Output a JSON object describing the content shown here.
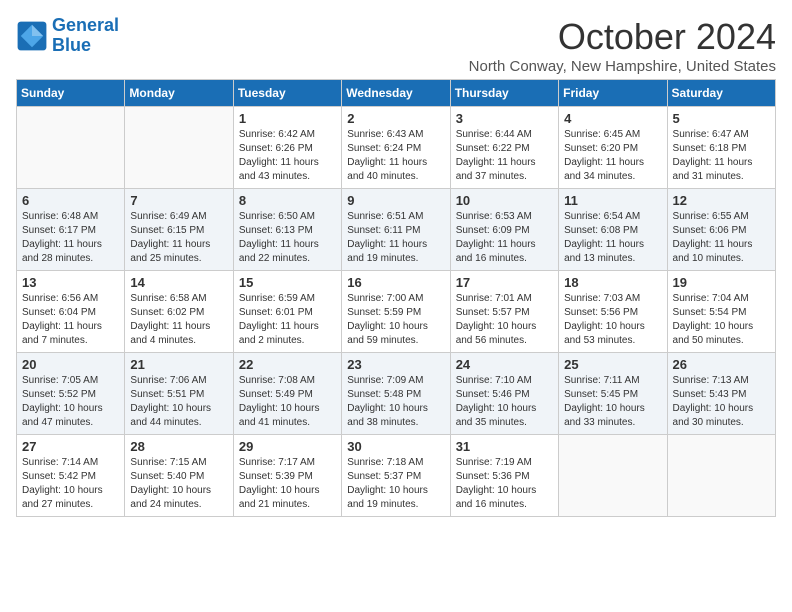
{
  "logo": {
    "line1": "General",
    "line2": "Blue"
  },
  "title": "October 2024",
  "location": "North Conway, New Hampshire, United States",
  "days_of_week": [
    "Sunday",
    "Monday",
    "Tuesday",
    "Wednesday",
    "Thursday",
    "Friday",
    "Saturday"
  ],
  "weeks": [
    [
      {
        "day": "",
        "sunrise": "",
        "sunset": "",
        "daylight": ""
      },
      {
        "day": "",
        "sunrise": "",
        "sunset": "",
        "daylight": ""
      },
      {
        "day": "1",
        "sunrise": "Sunrise: 6:42 AM",
        "sunset": "Sunset: 6:26 PM",
        "daylight": "Daylight: 11 hours and 43 minutes."
      },
      {
        "day": "2",
        "sunrise": "Sunrise: 6:43 AM",
        "sunset": "Sunset: 6:24 PM",
        "daylight": "Daylight: 11 hours and 40 minutes."
      },
      {
        "day": "3",
        "sunrise": "Sunrise: 6:44 AM",
        "sunset": "Sunset: 6:22 PM",
        "daylight": "Daylight: 11 hours and 37 minutes."
      },
      {
        "day": "4",
        "sunrise": "Sunrise: 6:45 AM",
        "sunset": "Sunset: 6:20 PM",
        "daylight": "Daylight: 11 hours and 34 minutes."
      },
      {
        "day": "5",
        "sunrise": "Sunrise: 6:47 AM",
        "sunset": "Sunset: 6:18 PM",
        "daylight": "Daylight: 11 hours and 31 minutes."
      }
    ],
    [
      {
        "day": "6",
        "sunrise": "Sunrise: 6:48 AM",
        "sunset": "Sunset: 6:17 PM",
        "daylight": "Daylight: 11 hours and 28 minutes."
      },
      {
        "day": "7",
        "sunrise": "Sunrise: 6:49 AM",
        "sunset": "Sunset: 6:15 PM",
        "daylight": "Daylight: 11 hours and 25 minutes."
      },
      {
        "day": "8",
        "sunrise": "Sunrise: 6:50 AM",
        "sunset": "Sunset: 6:13 PM",
        "daylight": "Daylight: 11 hours and 22 minutes."
      },
      {
        "day": "9",
        "sunrise": "Sunrise: 6:51 AM",
        "sunset": "Sunset: 6:11 PM",
        "daylight": "Daylight: 11 hours and 19 minutes."
      },
      {
        "day": "10",
        "sunrise": "Sunrise: 6:53 AM",
        "sunset": "Sunset: 6:09 PM",
        "daylight": "Daylight: 11 hours and 16 minutes."
      },
      {
        "day": "11",
        "sunrise": "Sunrise: 6:54 AM",
        "sunset": "Sunset: 6:08 PM",
        "daylight": "Daylight: 11 hours and 13 minutes."
      },
      {
        "day": "12",
        "sunrise": "Sunrise: 6:55 AM",
        "sunset": "Sunset: 6:06 PM",
        "daylight": "Daylight: 11 hours and 10 minutes."
      }
    ],
    [
      {
        "day": "13",
        "sunrise": "Sunrise: 6:56 AM",
        "sunset": "Sunset: 6:04 PM",
        "daylight": "Daylight: 11 hours and 7 minutes."
      },
      {
        "day": "14",
        "sunrise": "Sunrise: 6:58 AM",
        "sunset": "Sunset: 6:02 PM",
        "daylight": "Daylight: 11 hours and 4 minutes."
      },
      {
        "day": "15",
        "sunrise": "Sunrise: 6:59 AM",
        "sunset": "Sunset: 6:01 PM",
        "daylight": "Daylight: 11 hours and 2 minutes."
      },
      {
        "day": "16",
        "sunrise": "Sunrise: 7:00 AM",
        "sunset": "Sunset: 5:59 PM",
        "daylight": "Daylight: 10 hours and 59 minutes."
      },
      {
        "day": "17",
        "sunrise": "Sunrise: 7:01 AM",
        "sunset": "Sunset: 5:57 PM",
        "daylight": "Daylight: 10 hours and 56 minutes."
      },
      {
        "day": "18",
        "sunrise": "Sunrise: 7:03 AM",
        "sunset": "Sunset: 5:56 PM",
        "daylight": "Daylight: 10 hours and 53 minutes."
      },
      {
        "day": "19",
        "sunrise": "Sunrise: 7:04 AM",
        "sunset": "Sunset: 5:54 PM",
        "daylight": "Daylight: 10 hours and 50 minutes."
      }
    ],
    [
      {
        "day": "20",
        "sunrise": "Sunrise: 7:05 AM",
        "sunset": "Sunset: 5:52 PM",
        "daylight": "Daylight: 10 hours and 47 minutes."
      },
      {
        "day": "21",
        "sunrise": "Sunrise: 7:06 AM",
        "sunset": "Sunset: 5:51 PM",
        "daylight": "Daylight: 10 hours and 44 minutes."
      },
      {
        "day": "22",
        "sunrise": "Sunrise: 7:08 AM",
        "sunset": "Sunset: 5:49 PM",
        "daylight": "Daylight: 10 hours and 41 minutes."
      },
      {
        "day": "23",
        "sunrise": "Sunrise: 7:09 AM",
        "sunset": "Sunset: 5:48 PM",
        "daylight": "Daylight: 10 hours and 38 minutes."
      },
      {
        "day": "24",
        "sunrise": "Sunrise: 7:10 AM",
        "sunset": "Sunset: 5:46 PM",
        "daylight": "Daylight: 10 hours and 35 minutes."
      },
      {
        "day": "25",
        "sunrise": "Sunrise: 7:11 AM",
        "sunset": "Sunset: 5:45 PM",
        "daylight": "Daylight: 10 hours and 33 minutes."
      },
      {
        "day": "26",
        "sunrise": "Sunrise: 7:13 AM",
        "sunset": "Sunset: 5:43 PM",
        "daylight": "Daylight: 10 hours and 30 minutes."
      }
    ],
    [
      {
        "day": "27",
        "sunrise": "Sunrise: 7:14 AM",
        "sunset": "Sunset: 5:42 PM",
        "daylight": "Daylight: 10 hours and 27 minutes."
      },
      {
        "day": "28",
        "sunrise": "Sunrise: 7:15 AM",
        "sunset": "Sunset: 5:40 PM",
        "daylight": "Daylight: 10 hours and 24 minutes."
      },
      {
        "day": "29",
        "sunrise": "Sunrise: 7:17 AM",
        "sunset": "Sunset: 5:39 PM",
        "daylight": "Daylight: 10 hours and 21 minutes."
      },
      {
        "day": "30",
        "sunrise": "Sunrise: 7:18 AM",
        "sunset": "Sunset: 5:37 PM",
        "daylight": "Daylight: 10 hours and 19 minutes."
      },
      {
        "day": "31",
        "sunrise": "Sunrise: 7:19 AM",
        "sunset": "Sunset: 5:36 PM",
        "daylight": "Daylight: 10 hours and 16 minutes."
      },
      {
        "day": "",
        "sunrise": "",
        "sunset": "",
        "daylight": ""
      },
      {
        "day": "",
        "sunrise": "",
        "sunset": "",
        "daylight": ""
      }
    ]
  ]
}
